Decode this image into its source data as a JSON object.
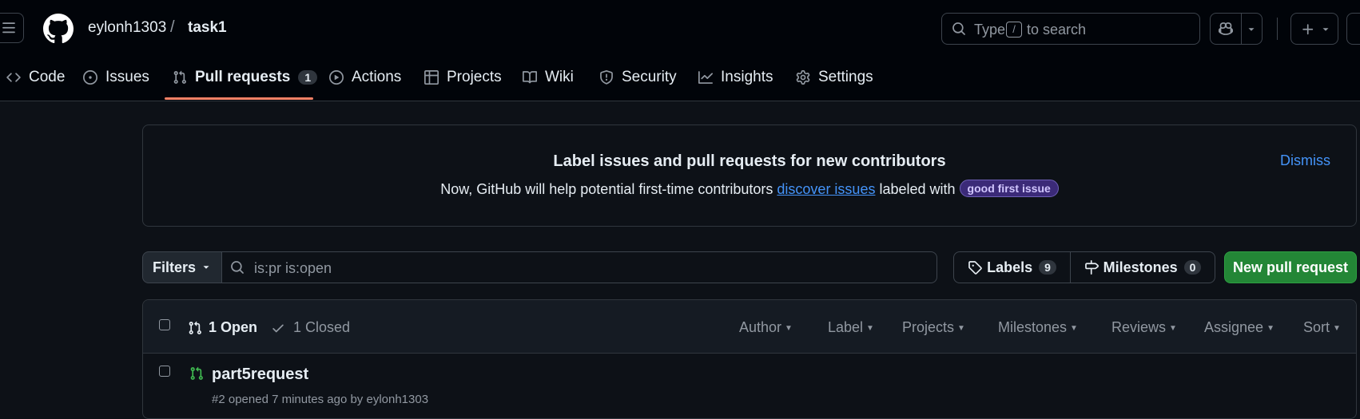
{
  "header": {
    "owner": "eylonh1303",
    "separator": "/",
    "repo": "task1",
    "search": {
      "prefix": "Type",
      "key": "/",
      "suffix": "to search"
    }
  },
  "tabs": [
    {
      "label": "Code",
      "icon": "code-icon"
    },
    {
      "label": "Issues",
      "icon": "issue-opened-icon"
    },
    {
      "label": "Pull requests",
      "icon": "git-pull-request-icon",
      "count": "1",
      "active": true
    },
    {
      "label": "Actions",
      "icon": "play-icon"
    },
    {
      "label": "Projects",
      "icon": "table-icon"
    },
    {
      "label": "Wiki",
      "icon": "book-icon"
    },
    {
      "label": "Security",
      "icon": "shield-icon"
    },
    {
      "label": "Insights",
      "icon": "graph-icon"
    },
    {
      "label": "Settings",
      "icon": "gear-icon"
    }
  ],
  "banner": {
    "title": "Label issues and pull requests for new contributors",
    "text_before": "Now, GitHub will help potential first-time contributors",
    "link": "discover issues",
    "text_after": "labeled with",
    "label": "good first issue",
    "dismiss": "Dismiss"
  },
  "toolbar": {
    "filters": "Filters",
    "query": "is:pr is:open",
    "labels": "Labels",
    "labels_count": "9",
    "milestones": "Milestones",
    "milestones_count": "0",
    "new_pr": "New pull request"
  },
  "list": {
    "open": "1 Open",
    "closed": "1 Closed",
    "sorters": [
      "Author",
      "Label",
      "Projects",
      "Milestones",
      "Reviews",
      "Assignee",
      "Sort"
    ],
    "items": [
      {
        "title": "part5request",
        "meta": "#2 opened 7 minutes ago by eylonh1303"
      }
    ]
  },
  "colors": {
    "accent_underline": "#f78166",
    "link": "#4493f8",
    "primary_button": "#238636",
    "open_pr_icon": "#3fb950"
  }
}
